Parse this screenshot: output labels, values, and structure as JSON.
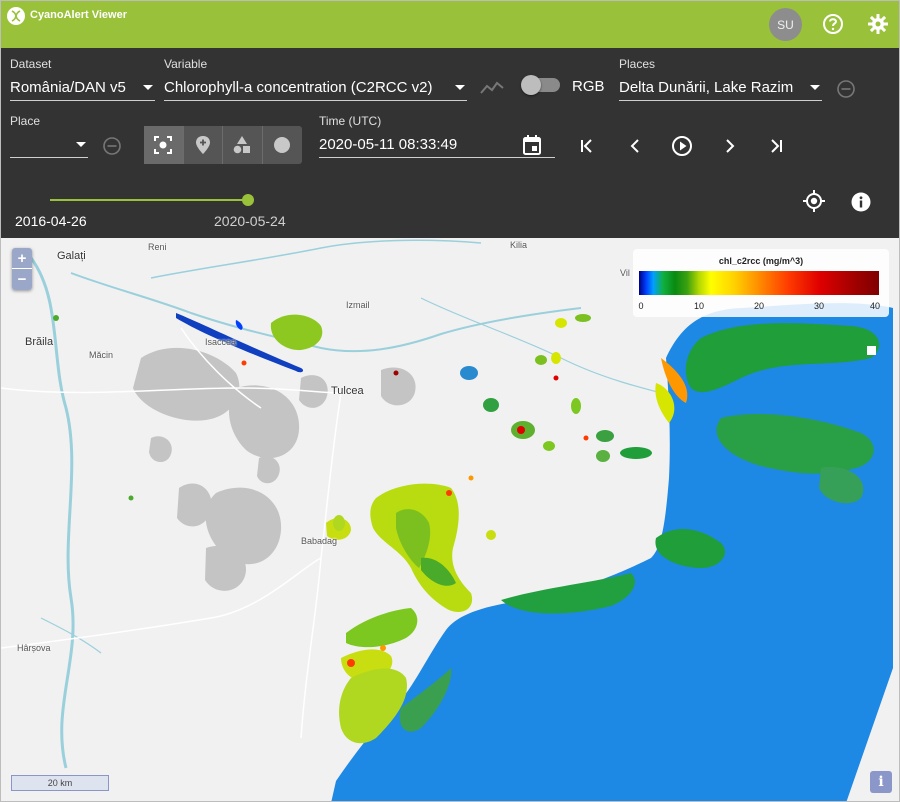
{
  "app": {
    "title": "CyanoAlert Viewer",
    "user_initials": "SU"
  },
  "icons": {
    "logo": "dna-icon",
    "help": "help-circle-icon",
    "settings": "gear-icon",
    "timeseries": "timeseries-icon",
    "remove": "minus-circle-icon",
    "select": "focus-select-icon",
    "point": "map-pin-plus-icon",
    "shapes": "shapes-icon",
    "circle": "circle-icon",
    "calendar": "calendar-icon",
    "first": "skip-first-icon",
    "prev": "chevron-left-icon",
    "play": "play-circle-icon",
    "next": "chevron-right-icon",
    "last": "skip-last-icon",
    "locate": "crosshair-icon",
    "info": "info-icon"
  },
  "colors": {
    "accent": "#9ac13a",
    "panel": "#333333",
    "map_bg": "#f1f1f1",
    "sea": "#1e88e5"
  },
  "controls": {
    "dataset": {
      "label": "Dataset",
      "value": "România/DAN v5"
    },
    "variable": {
      "label": "Variable",
      "value": "Chlorophyll-a concentration (C2RCC v2)"
    },
    "rgb": {
      "label": "RGB",
      "enabled": false
    },
    "places": {
      "label": "Places",
      "value": "Delta Dunării, Lake Razim"
    },
    "place": {
      "label": "Place",
      "value": ""
    },
    "time": {
      "label": "Time (UTC)",
      "value": "2020-05-11 08:33:49"
    },
    "time_range": {
      "start": "2016-04-26",
      "end": "2020-05-24",
      "position": 1.0
    }
  },
  "map": {
    "zoom_in": "+",
    "zoom_out": "−",
    "legend": {
      "title": "chl_c2rcc (mg/m^3)",
      "ticks": [
        "0",
        "10",
        "20",
        "30",
        "40"
      ],
      "min": 0,
      "max": 40
    },
    "towns": {
      "galati": "Galați",
      "braila": "Brăila",
      "macin": "Măcin",
      "isaccea": "Isaccea",
      "tulcea": "Tulcea",
      "babadag": "Babadag",
      "harsova": "Hârșova",
      "reni": "Reni",
      "izmail": "Izmail",
      "kilia": "Kilia",
      "vilkove": "Vil"
    },
    "scale": "20 km",
    "info": "i"
  }
}
